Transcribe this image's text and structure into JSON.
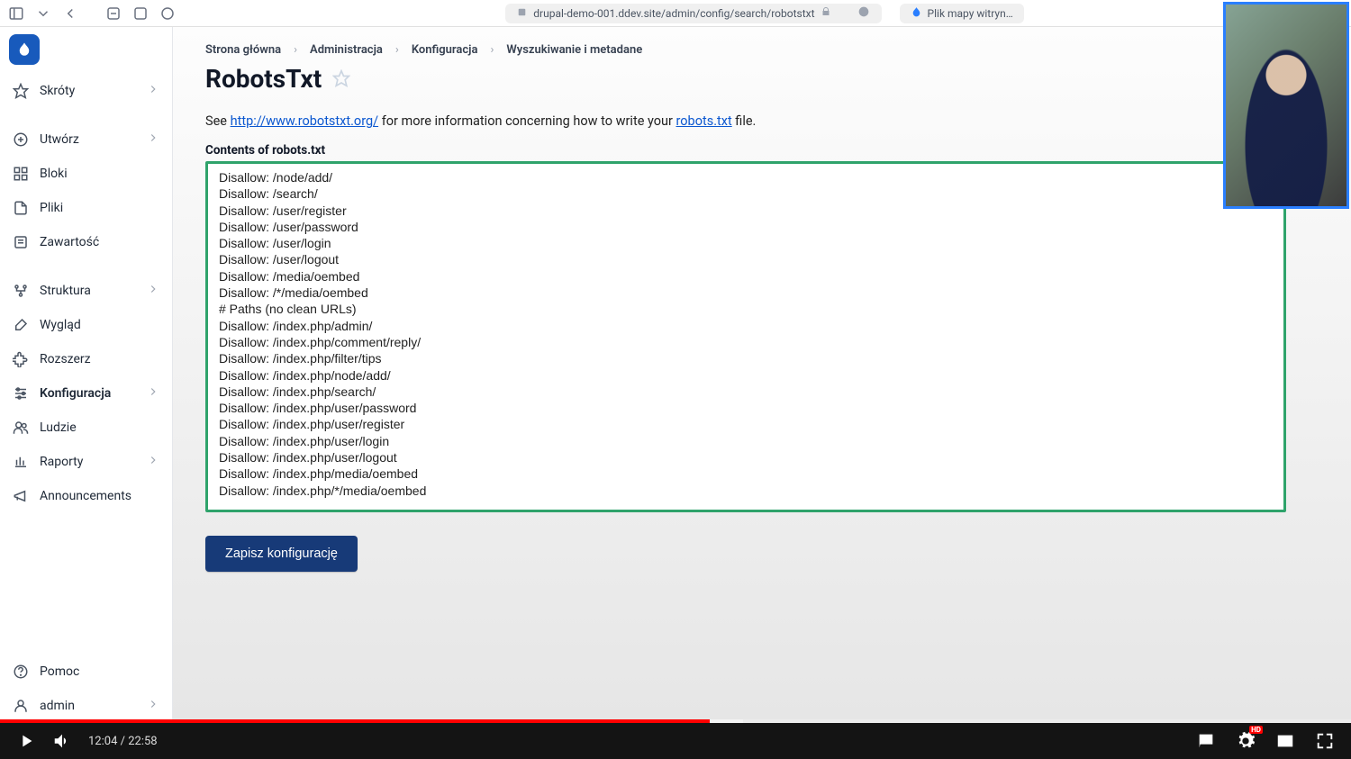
{
  "browser": {
    "url": "drupal-demo-001.ddev.site/admin/config/search/robotstxt",
    "tab_label": "Plik mapy witryn…"
  },
  "sidebar": {
    "items": [
      {
        "label": "Skróty",
        "icon": "star-icon",
        "chev": true
      },
      {
        "label": "Utwórz",
        "icon": "plus-circle-icon",
        "chev": true
      },
      {
        "label": "Bloki",
        "icon": "blocks-icon",
        "chev": false
      },
      {
        "label": "Pliki",
        "icon": "files-icon",
        "chev": false
      },
      {
        "label": "Zawartość",
        "icon": "content-icon",
        "chev": false
      },
      {
        "label": "Struktura",
        "icon": "structure-icon",
        "chev": true
      },
      {
        "label": "Wygląd",
        "icon": "brush-icon",
        "chev": false
      },
      {
        "label": "Rozszerz",
        "icon": "puzzle-icon",
        "chev": false
      },
      {
        "label": "Konfiguracja",
        "icon": "sliders-icon",
        "chev": true,
        "active": true
      },
      {
        "label": "Ludzie",
        "icon": "users-icon",
        "chev": false
      },
      {
        "label": "Raporty",
        "icon": "reports-icon",
        "chev": true
      },
      {
        "label": "Announcements",
        "icon": "megaphone-icon",
        "chev": false
      }
    ],
    "footer": [
      {
        "label": "Pomoc",
        "icon": "help-icon",
        "chev": false
      },
      {
        "label": "admin",
        "icon": "user-icon",
        "chev": true
      }
    ]
  },
  "breadcrumb": [
    "Strona główna",
    "Administracja",
    "Konfiguracja",
    "Wyszukiwanie i metadane"
  ],
  "page_title": "RobotsTxt",
  "description": {
    "prefix": "See ",
    "link1": "http://www.robotstxt.org/",
    "mid": " for more information concerning how to write your ",
    "link2": "robots.txt",
    "suffix": " file."
  },
  "field_label": "Contents of robots.txt",
  "robots_content": "Disallow: /node/add/\nDisallow: /search/\nDisallow: /user/register\nDisallow: /user/password\nDisallow: /user/login\nDisallow: /user/logout\nDisallow: /media/oembed\nDisallow: /*/media/oembed\n# Paths (no clean URLs)\nDisallow: /index.php/admin/\nDisallow: /index.php/comment/reply/\nDisallow: /index.php/filter/tips\nDisallow: /index.php/node/add/\nDisallow: /index.php/search/\nDisallow: /index.php/user/password\nDisallow: /index.php/user/register\nDisallow: /index.php/user/login\nDisallow: /index.php/user/logout\nDisallow: /index.php/media/oembed\nDisallow: /index.php/*/media/oembed",
  "save_button": "Zapisz konfigurację",
  "video": {
    "current": "12:04",
    "total": "22:58",
    "hd": "HD"
  }
}
